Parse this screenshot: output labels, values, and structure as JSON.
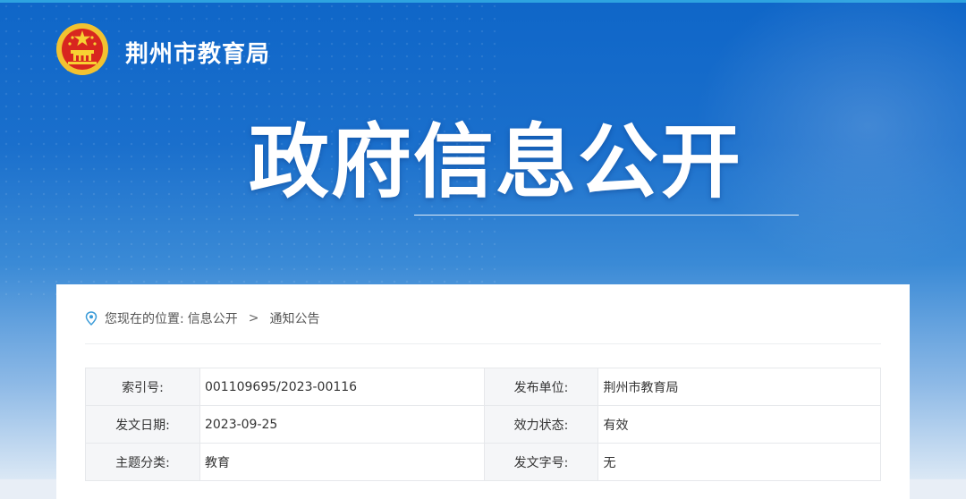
{
  "header": {
    "site_title": "荆州市教育局",
    "main_title": "政府信息公开"
  },
  "breadcrumb": {
    "prefix": "您现在的位置:",
    "items": [
      "信息公开",
      "通知公告"
    ],
    "separator": ">"
  },
  "meta": {
    "rows": [
      {
        "label1": "索引号:",
        "value1": "001109695/2023-00116",
        "label2": "发布单位:",
        "value2": "荆州市教育局"
      },
      {
        "label1": "发文日期:",
        "value1": "2023-09-25",
        "label2": "效力状态:",
        "value2": "有效"
      },
      {
        "label1": "主题分类:",
        "value1": "教育",
        "label2": "发文字号:",
        "value2": "无"
      }
    ]
  },
  "colors": {
    "banner_top": "#0f66c8",
    "banner_bottom": "#dbe8f5",
    "accent_line": "#2ea3e0",
    "pin": "#3a9bd8"
  },
  "icons": {
    "emblem": "national-emblem-icon",
    "pin": "location-pin-icon"
  }
}
